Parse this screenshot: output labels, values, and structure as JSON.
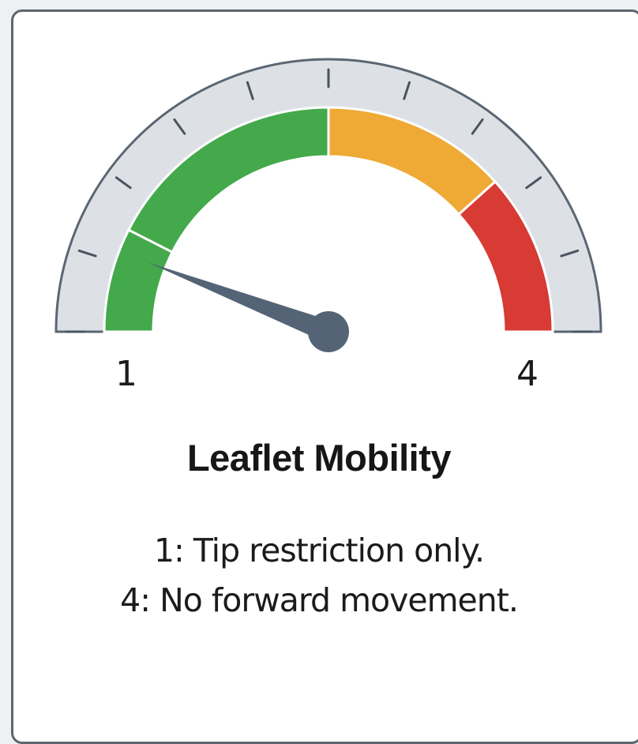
{
  "gauge": {
    "min": 1,
    "max": 4,
    "value": 1.35,
    "min_label": "1",
    "max_label": "4",
    "major_ticks": 10,
    "bands": [
      {
        "from": 1.0,
        "to": 1.45,
        "color": "#43a94b"
      },
      {
        "from": 1.45,
        "to": 2.5,
        "color": "#43a94b"
      },
      {
        "from": 2.5,
        "to": 3.3,
        "color": "#eeaa35"
      },
      {
        "from": 3.3,
        "to": 4.0,
        "color": "#d83a34"
      }
    ],
    "colors": {
      "track": "#dde1e6",
      "track_outline": "#5b6673",
      "needle": "#546476",
      "tick": "#4a5460"
    }
  },
  "title": "Leaflet Mobility",
  "legend": [
    "1: Tip restriction only.",
    "4: No forward movement."
  ]
}
